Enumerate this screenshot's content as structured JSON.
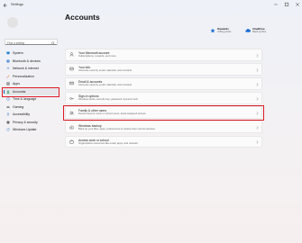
{
  "app": {
    "title": "Settings"
  },
  "search": {
    "placeholder": "Find a setting"
  },
  "sidebar": {
    "items": [
      {
        "label": "System",
        "icon": "monitor-icon"
      },
      {
        "label": "Bluetooth & devices",
        "icon": "bluetooth-icon"
      },
      {
        "label": "Network & internet",
        "icon": "wifi-icon"
      },
      {
        "label": "Personalization",
        "icon": "brush-icon"
      },
      {
        "label": "Apps",
        "icon": "apps-icon"
      },
      {
        "label": "Accounts",
        "icon": "person-icon",
        "selected": true
      },
      {
        "label": "Time & language",
        "icon": "globe-clock-icon"
      },
      {
        "label": "Gaming",
        "icon": "gamepad-icon"
      },
      {
        "label": "Accessibility",
        "icon": "accessibility-icon"
      },
      {
        "label": "Privacy & security",
        "icon": "shield-icon"
      },
      {
        "label": "Windows Update",
        "icon": "refresh-icon"
      }
    ]
  },
  "main": {
    "title": "Accounts",
    "status": [
      {
        "title": "Rewards",
        "subtitle": "0 Bing points",
        "icon": "rewards-icon"
      },
      {
        "title": "OneDrive",
        "subtitle": "Back up files",
        "icon": "cloud-icon"
      }
    ],
    "cards": [
      {
        "title": "Your Microsoft account",
        "subtitle": "Subscriptions, rewards, and more",
        "icon": "person-card-icon"
      },
      {
        "title": "Your info",
        "subtitle": "Accounts used by email, calendar, and contacts",
        "icon": "id-card-icon"
      },
      {
        "title": "Email & accounts",
        "subtitle": "Accounts used by email, calendar, and contacts",
        "icon": "mail-icon"
      },
      {
        "title": "Sign-in options",
        "subtitle": "Windows Hello, security key, password, dynamic lock",
        "icon": "key-icon"
      },
      {
        "title": "Family & other users",
        "subtitle": "Device access, work or school users, kiosk assigned access",
        "icon": "family-icon",
        "highlighted": true
      },
      {
        "title": "Windows backup",
        "subtitle": "Back up your files, apps, preferences to restore them across devices",
        "icon": "backup-icon"
      },
      {
        "title": "Access work or school",
        "subtitle": "Organization resources like email, apps, and network",
        "icon": "briefcase-icon"
      }
    ]
  },
  "colors": {
    "accent": "#005fb8",
    "highlight_box": "#e01b24"
  }
}
